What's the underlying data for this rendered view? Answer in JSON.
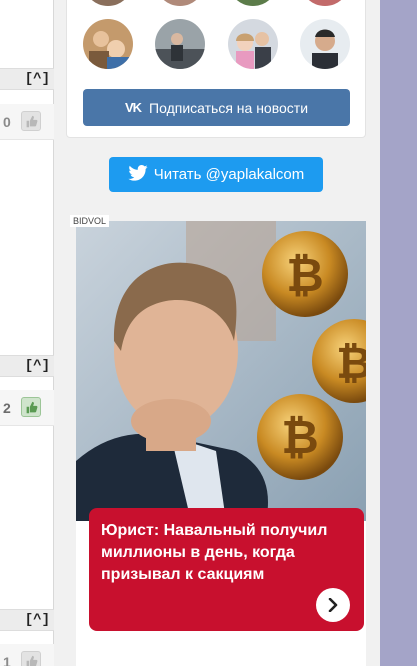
{
  "left_column": {
    "up_buttons": [
      "[^]",
      "[^]",
      "[^]"
    ],
    "ratings": [
      {
        "count": "0",
        "active": false
      },
      {
        "count": "2",
        "active": true
      },
      {
        "count": "1",
        "active": false
      }
    ]
  },
  "vk_widget": {
    "subscribe_label": "Подписаться на новости",
    "logo_text": "VK"
  },
  "twitter": {
    "follow_label": "Читать @yaplakalcom"
  },
  "ad": {
    "source_label": "BIDVOL",
    "title": "Юрист: Навальный получил миллионы в день, когда призывал к сакциям",
    "icons": {
      "arrow": "chevron-right-icon",
      "coin": "bitcoin-coin"
    }
  },
  "colors": {
    "vk": "#4a76a8",
    "twitter": "#1d9bf0",
    "ad_box": "#c8102e",
    "right_strip": "#a4a4c8"
  }
}
